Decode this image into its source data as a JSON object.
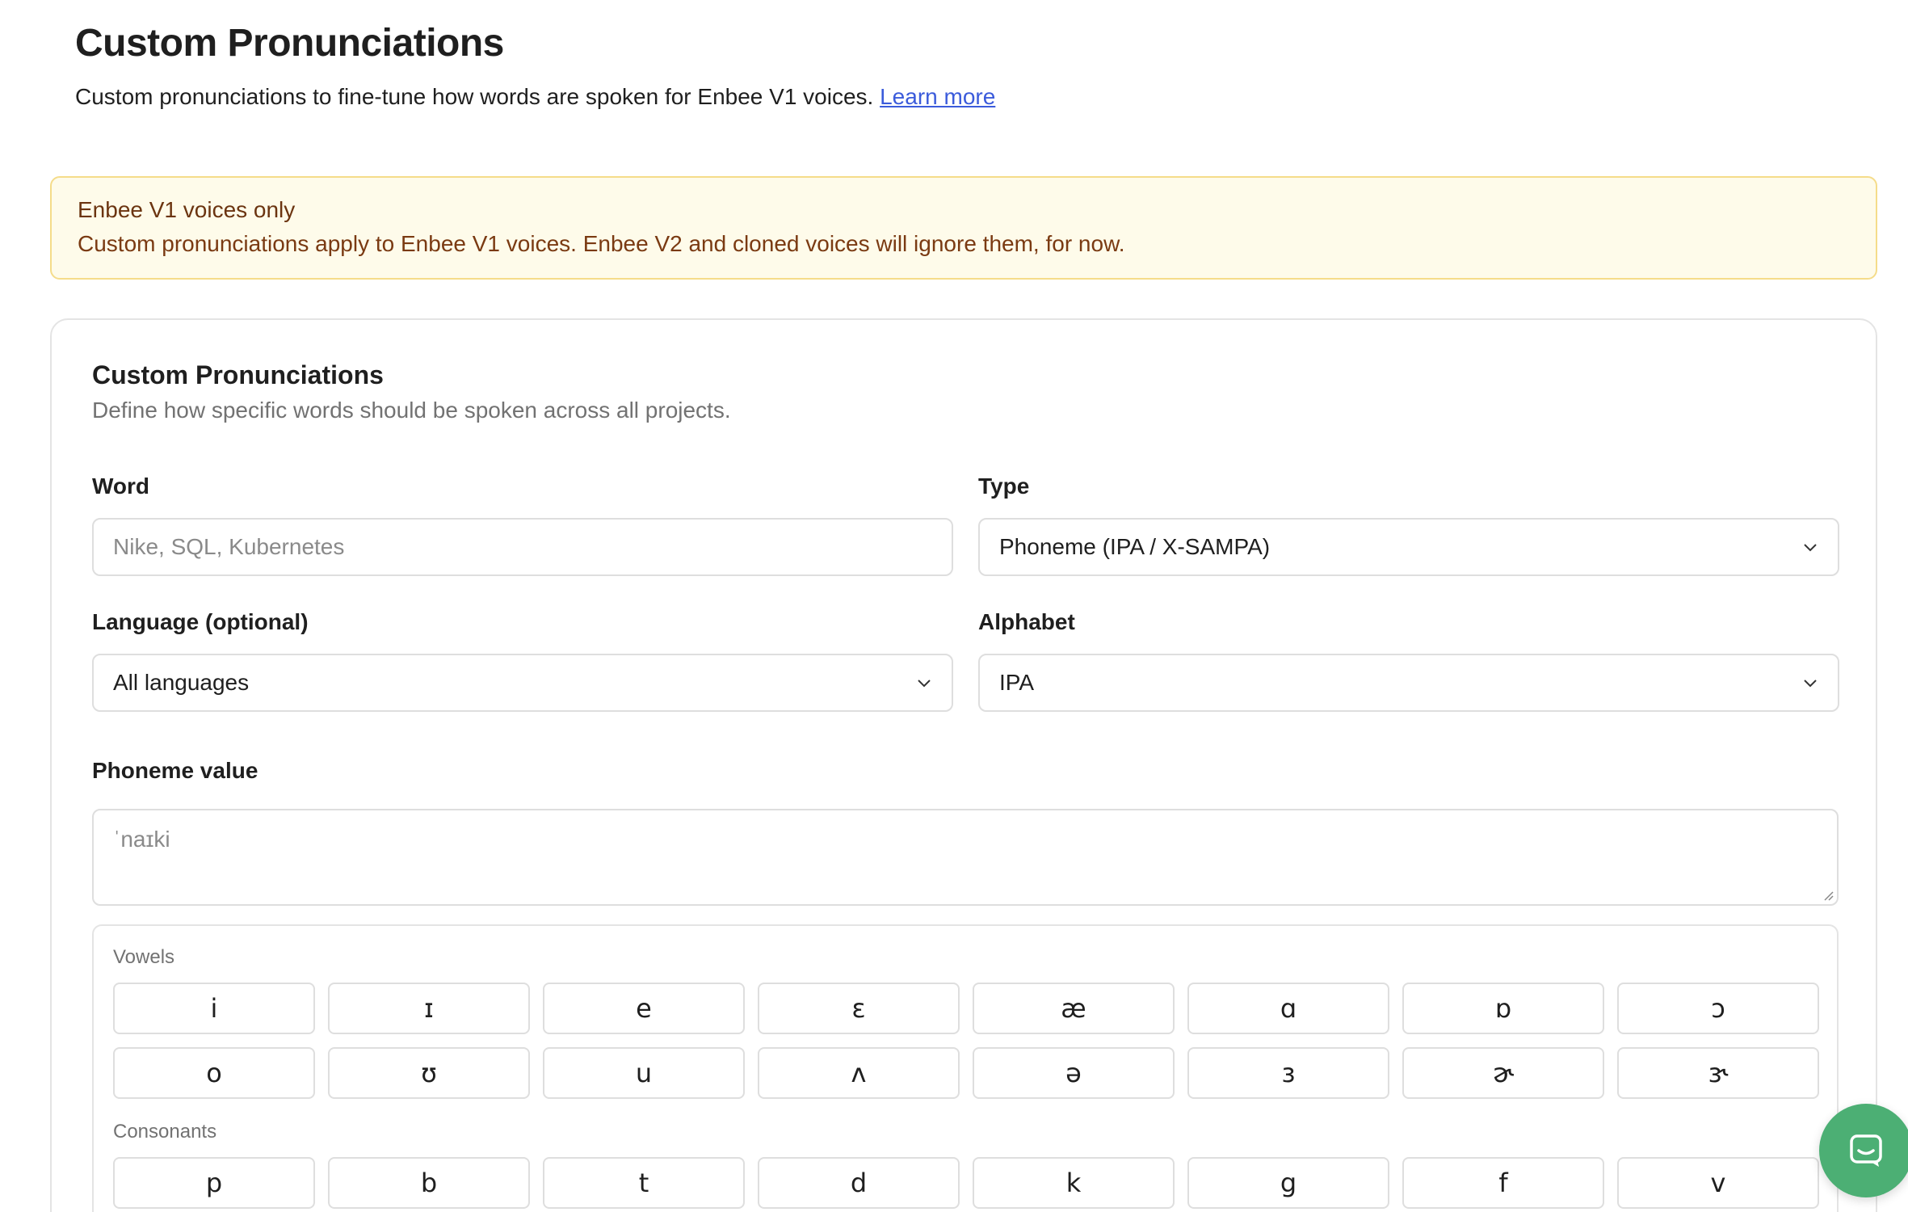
{
  "header": {
    "title": "Custom Pronunciations",
    "subtitle": "Custom pronunciations to fine-tune how words are spoken for Enbee V1 voices.",
    "learn_more": "Learn more"
  },
  "notice": {
    "title": "Enbee V1 voices only",
    "text": "Custom pronunciations apply to Enbee V1 voices. Enbee V2 and cloned voices will ignore them, for now."
  },
  "card": {
    "title": "Custom Pronunciations",
    "description": "Define how specific words should be spoken across all projects."
  },
  "form": {
    "word": {
      "label": "Word",
      "placeholder": "Nike, SQL, Kubernetes"
    },
    "type": {
      "label": "Type",
      "value": "Phoneme (IPA / X-SAMPA)"
    },
    "language": {
      "label": "Language (optional)",
      "value": "All languages"
    },
    "alphabet": {
      "label": "Alphabet",
      "value": "IPA"
    },
    "phoneme": {
      "label": "Phoneme value",
      "placeholder": "ˈnaɪki"
    }
  },
  "keyboard": {
    "vowels_label": "Vowels",
    "vowels_row1": [
      "i",
      "ɪ",
      "e",
      "ɛ",
      "æ",
      "ɑ",
      "ɒ",
      "ɔ"
    ],
    "vowels_row2": [
      "o",
      "ʊ",
      "u",
      "ʌ",
      "ə",
      "ɜ",
      "ɚ",
      "ɝ"
    ],
    "consonants_label": "Consonants",
    "consonants_row1": [
      "p",
      "b",
      "t",
      "d",
      "k",
      "g",
      "f",
      "v"
    ]
  },
  "colors": {
    "notice_bg": "#fefbea",
    "notice_border": "#f5dc8a",
    "link": "#3b5bdb",
    "chat_button": "#4caf74"
  },
  "icons": {
    "chevron": "chevron-down-icon",
    "chat": "chat-bubble-icon"
  }
}
